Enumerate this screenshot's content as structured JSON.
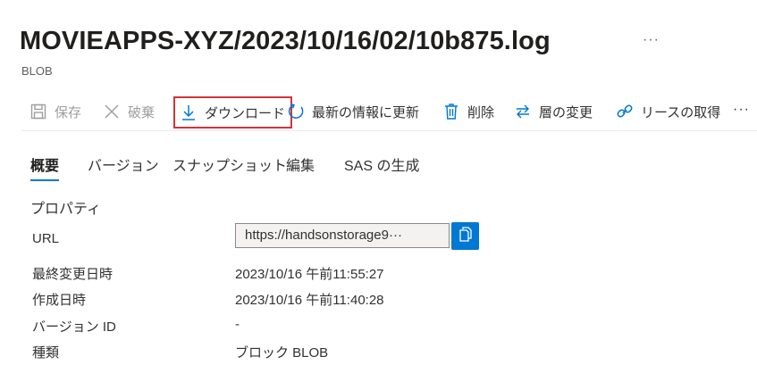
{
  "header": {
    "title": "MOVIEAPPS-XYZ/2023/10/16/02/10b875.log",
    "more": "···",
    "subtitle": "BLOB"
  },
  "toolbar": {
    "save": "保存",
    "discard": "破棄",
    "download": "ダウンロード",
    "refresh": "最新の情報に更新",
    "delete": "削除",
    "change_tier": "層の変更",
    "acquire_lease": "リースの取得",
    "more": "···",
    "icons": [
      "save-icon",
      "close-icon",
      "download-icon",
      "refresh-icon",
      "trash-icon",
      "swap-icon",
      "link-icon"
    ]
  },
  "tabs": [
    {
      "label": "概要",
      "active": true
    },
    {
      "label": "バージョン",
      "active": false
    },
    {
      "label": "スナップショット",
      "active": false
    },
    {
      "label": "編集",
      "active": false
    },
    {
      "label": "SAS の生成",
      "active": false
    }
  ],
  "properties": {
    "section_title": "プロパティ",
    "url": {
      "label": "URL",
      "value": "https://handsonstorage9···"
    },
    "last_modified": {
      "label": "最終変更日時",
      "value": "2023/10/16 午前11:55:27"
    },
    "created": {
      "label": "作成日時",
      "value": "2023/10/16 午前11:40:28"
    },
    "version_id": {
      "label": "バージョン ID",
      "value": "-"
    },
    "type": {
      "label": "種類",
      "value": "ブロック BLOB"
    }
  },
  "colors": {
    "accent": "#0078d4",
    "highlight": "#d13438",
    "disabled": "#a19f9d"
  }
}
